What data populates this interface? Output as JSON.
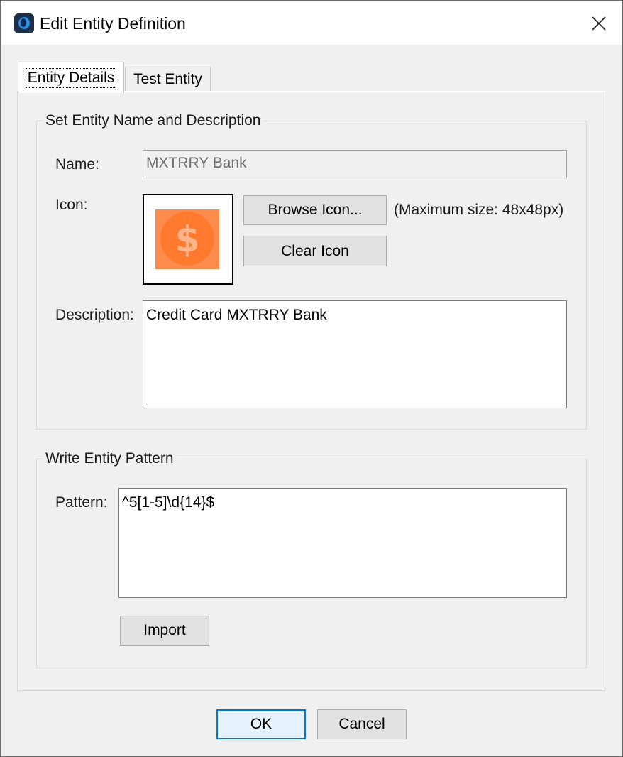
{
  "window": {
    "title": "Edit Entity Definition",
    "close_glyph": "×"
  },
  "tabs": [
    {
      "label": "Entity Details",
      "active": true
    },
    {
      "label": "Test Entity",
      "active": false
    }
  ],
  "details_group": {
    "legend": "Set Entity Name and Description",
    "name_label": "Name:",
    "name_value": "MXTRRY Bank",
    "icon_label": "Icon:",
    "icon_name": "money-dollar-icon",
    "browse_button": "Browse Icon...",
    "size_hint": "(Maximum size: 48x48px)",
    "clear_button": "Clear Icon",
    "description_label": "Description:",
    "description_value": "Credit Card MXTRRY Bank"
  },
  "pattern_group": {
    "legend": "Write Entity Pattern",
    "pattern_label": "Pattern:",
    "pattern_value": "^5[1-5]\\d{14}$",
    "import_button": "Import"
  },
  "footer": {
    "ok_button": "OK",
    "cancel_button": "Cancel"
  },
  "colors": {
    "accent": "#0078d7",
    "icon_orange": "#ff7a2e"
  }
}
